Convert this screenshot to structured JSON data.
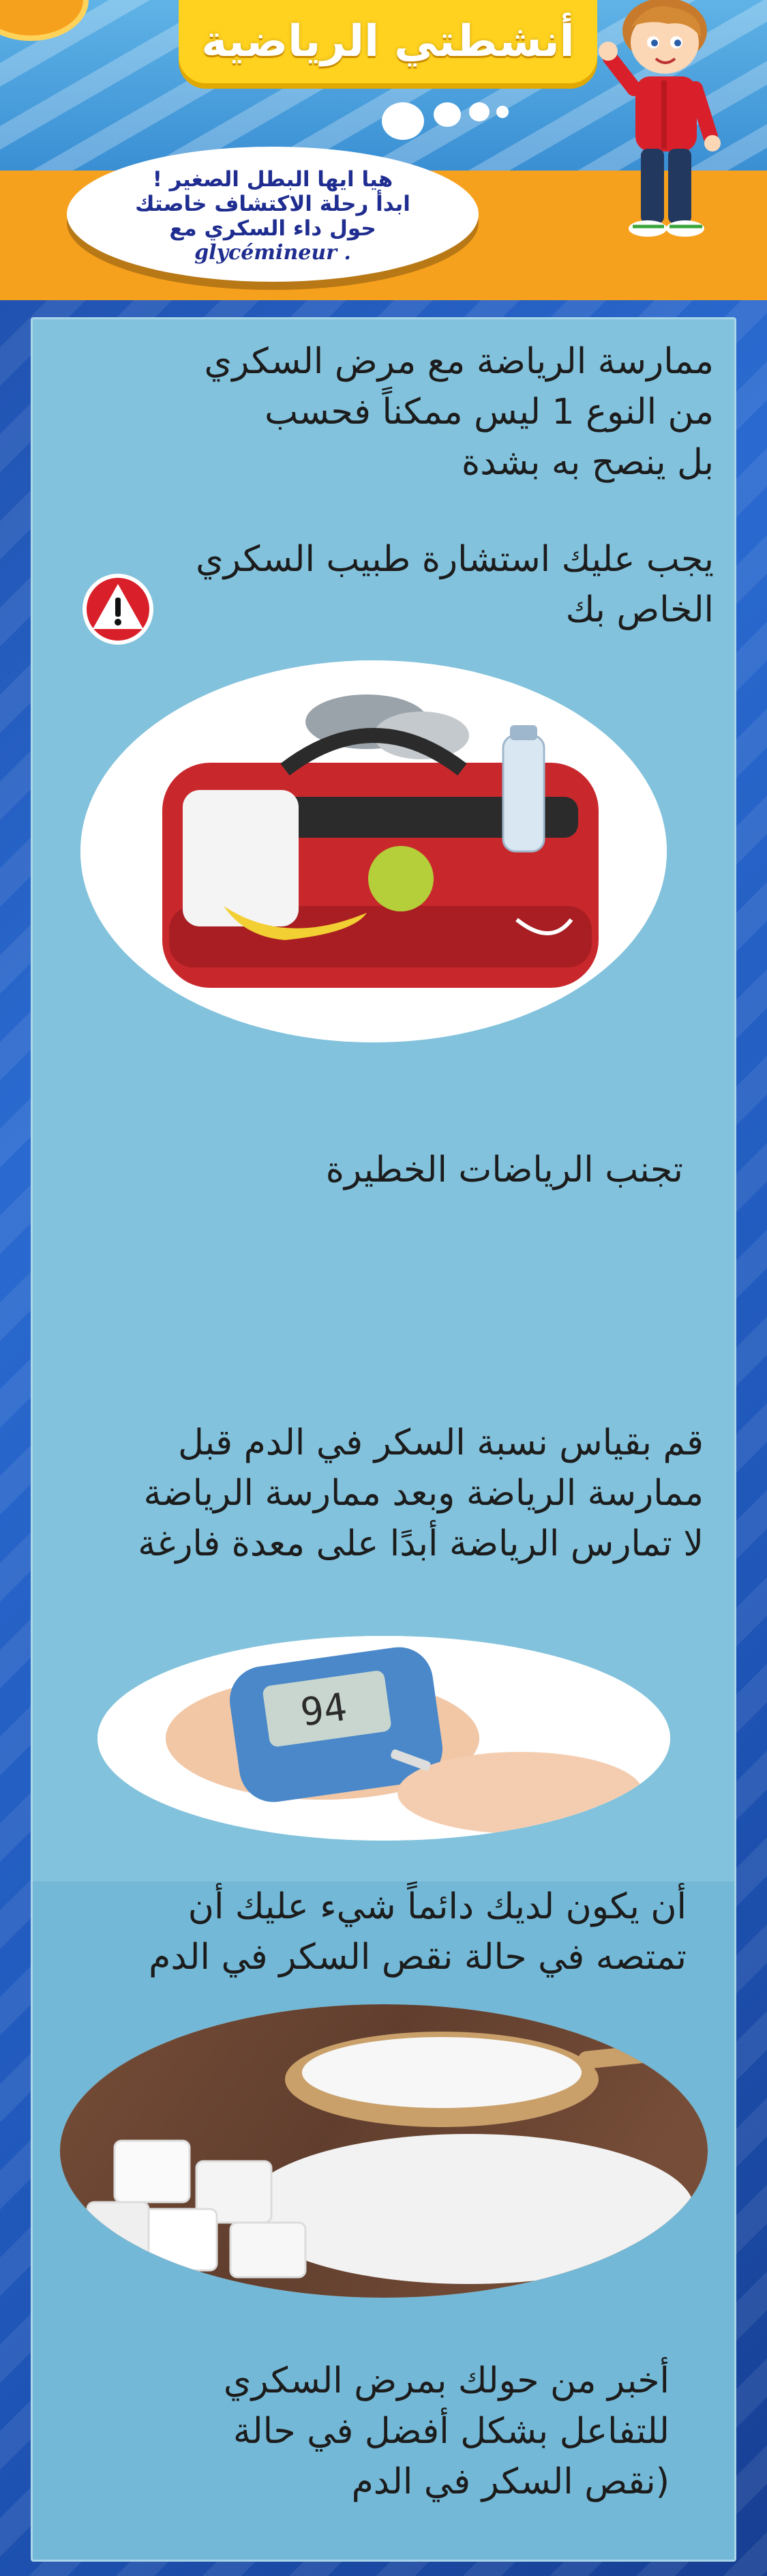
{
  "header": {
    "title": "أنشطتي الرياضية",
    "bubble_lines": [
      "هيا ايها البطل الصغير !",
      "ابدأ رحلة الاكتشاف خاصتك",
      "حول داء السكري مع"
    ],
    "bubble_brand": "glycémineur ."
  },
  "sections": {
    "intro": [
      "ممارسة الرياضة مع مرض السكري",
      "من النوع 1 ليس ممكناً فحسب",
      "بل ينصح به بشدة"
    ],
    "doctor": [
      "يجب عليك استشارة طبيب السكري",
      "الخاص بك"
    ],
    "avoid": [
      "تجنب الرياضات الخطيرة"
    ],
    "measure": [
      "قم بقياس نسبة السكر في الدم قبل",
      "ممارسة الرياضة وبعد ممارسة الرياضة",
      "لا تمارس الرياضة أبدًا على معدة فارغة"
    ],
    "sugar": [
      "أن يكون لديك دائماً شيء عليك أن",
      "تمتصه في حالة نقص السكر في الدم"
    ],
    "tell": [
      "أخبر من حولك بمرض السكري",
      "للتفاعل بشكل أفضل في حالة",
      "(نقص السكر في الدم"
    ]
  },
  "glucometer_reading": "94",
  "colors": {
    "panel": "#82c2dc",
    "orange": "#f6a11d",
    "banner": "#ffd21f",
    "bubble_text": "#1e2d8f",
    "warning_red": "#d9202a"
  },
  "icons": [
    "warning-icon",
    "sports-bag-image",
    "glucometer-image",
    "sugar-image",
    "boy-mascot"
  ]
}
